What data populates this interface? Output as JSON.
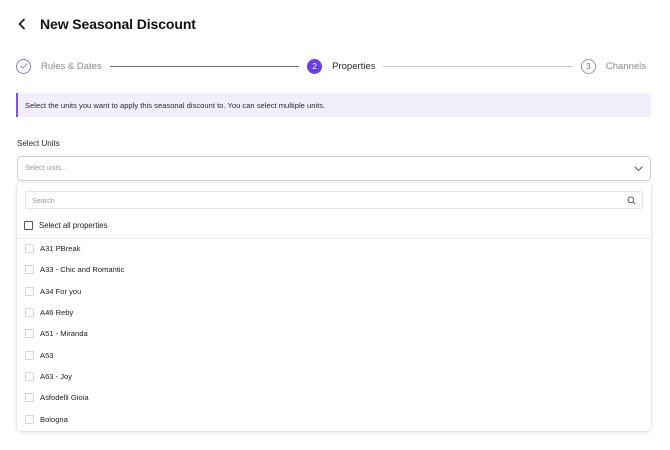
{
  "header": {
    "title": "New Seasonal Discount"
  },
  "stepper": {
    "steps": [
      {
        "label": "Rules & Dates",
        "number": "",
        "state": "done"
      },
      {
        "label": "Properties",
        "number": "2",
        "state": "active"
      },
      {
        "label": "Channels",
        "number": "3",
        "state": "todo"
      }
    ]
  },
  "info_banner": {
    "text": "Select the units you want to apply this seasonal discount to. You can select multiple units."
  },
  "units_field": {
    "label": "Select Units",
    "placeholder": "Select units..."
  },
  "dropdown": {
    "search_placeholder": "Search",
    "select_all_label": "Select all properties",
    "units": [
      "A31 PBreak",
      "A33 - Chic and Romantic",
      "A34 For you",
      "A46 Reby",
      "A51 - Miranda",
      "A53",
      "A63 - Joy",
      "Asfodelli Gioia",
      "Bologna"
    ]
  },
  "colors": {
    "accent": "#6c3fe0",
    "banner_bg": "#f2eefc",
    "banner_border": "#7a55e6"
  },
  "icons": {
    "back": "chevron-left-icon",
    "done_step": "check-icon",
    "dropdown": "chevron-down-icon",
    "search": "search-icon"
  }
}
